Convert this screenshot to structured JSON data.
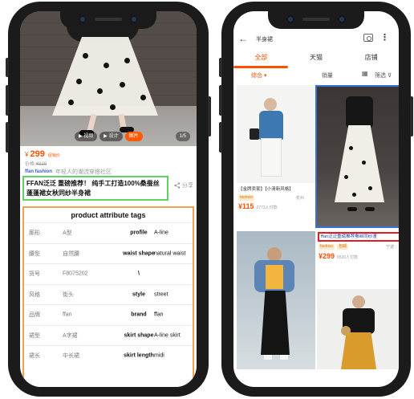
{
  "left_screen": {
    "hero": {
      "pill_1": "▶ 视频",
      "pill_2": "▶ 设计",
      "pill_3": "图片",
      "pager": "1/5"
    },
    "price": {
      "currency": "¥",
      "value": "299",
      "tag": "促销价"
    },
    "original_price": {
      "label": "价格",
      "value": "¥329"
    },
    "shop": {
      "logo": "ffan fashion",
      "slogan": "年轻人的潮流穿搭社区"
    },
    "title": "FFAN泛泛 重磅推荐！ 纯手工打造100%桑蚕丝蓬蓬裙女秋同纱半身裙",
    "share_label": "分享",
    "attributes": {
      "header": "product attribute tags",
      "rows": [
        {
          "key": "廓形",
          "value": "A型",
          "tag_key": "profile",
          "tag_value": "A-line"
        },
        {
          "key": "腰型",
          "value": "自然腰",
          "tag_key": "waist shape",
          "tag_value": "natural waist"
        },
        {
          "key": "货号",
          "value": "F8075202",
          "tag_key": "\\",
          "tag_value": ""
        },
        {
          "key": "风格",
          "value": "街头",
          "tag_key": "style",
          "tag_value": "street"
        },
        {
          "key": "品牌",
          "value": "ffan",
          "tag_key": "brand",
          "tag_value": "ffan"
        },
        {
          "key": "裙型",
          "value": "A字裙",
          "tag_key": "skirt shape",
          "tag_value": "A-line skirt"
        },
        {
          "key": "裙长",
          "value": "中长裙",
          "tag_key": "skirt length",
          "tag_value": "midi"
        }
      ]
    }
  },
  "right_screen": {
    "search_query": "半身裙",
    "tabs": [
      "全部",
      "天猫",
      "店铺"
    ],
    "sort": {
      "default": "综合 ▾",
      "sales": "销量",
      "layout_icon": "grid-icon",
      "filter": "筛选"
    },
    "card1": {
      "title": "【金牌卖家】【小清新风格】",
      "badge": "fashion",
      "location": "杭州",
      "price": "¥115",
      "sold": "2773人付款"
    },
    "card2": {
      "title": "ffan泛泛重磅推荐蚕丝同纱漫",
      "badge_1": "fashion",
      "badge_2": "包邮",
      "location": "宁波",
      "price": "¥299",
      "sold": "6520人付款"
    }
  },
  "colors": {
    "accent": "#ff5000",
    "title_box": "#5fd35f",
    "attr_box": "#f0a050",
    "highlight_blue": "#3a6fd8",
    "highlight_red": "#e02020"
  }
}
